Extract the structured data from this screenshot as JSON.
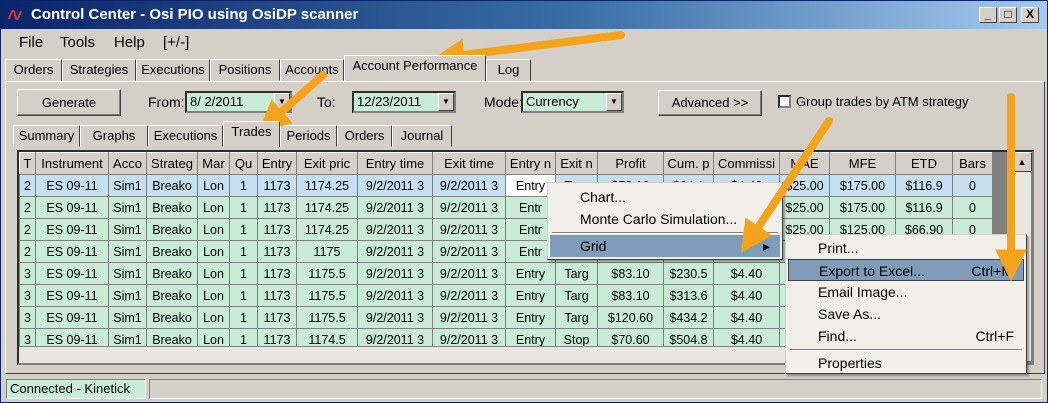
{
  "window": {
    "title": "Control Center - Osi PIO using OsiDP scanner",
    "buttons": {
      "minimize": "_",
      "maximize": "□",
      "close": "X"
    }
  },
  "menubar": [
    "File",
    "Tools",
    "Help",
    "[+/-]"
  ],
  "main_tabs": [
    "Orders",
    "Strategies",
    "Executions",
    "Positions",
    "Accounts",
    "Account Performance",
    "Log"
  ],
  "controls": {
    "generate": "Generate",
    "from_label": "From:",
    "from_value": "8/ 2/2011",
    "to_label": "To:",
    "to_value": "12/23/2011",
    "mode_label": "Mode:",
    "mode_value": "Currency",
    "advanced": "Advanced >>",
    "group_trades": "Group trades by ATM strategy"
  },
  "sub_tabs": [
    "Summary",
    "Graphs",
    "Executions",
    "Trades",
    "Periods",
    "Orders",
    "Journal"
  ],
  "grid": {
    "columns": [
      "T",
      "Instrument",
      "Acco",
      "Strateg",
      "Mar",
      "Qu",
      "Entry",
      "Exit pric",
      "Entry time",
      "Exit time",
      "Entry n",
      "Exit n",
      "Profit",
      "Cum. p",
      "Commissi",
      "MAE",
      "MFE",
      "ETD",
      "Bars"
    ],
    "rows": [
      [
        "2",
        "ES 09-11",
        "Sim1",
        "Breako",
        "Lon",
        "1",
        "1173",
        "1174.25",
        "9/2/2011 3",
        "9/2/2011 3",
        "Entry",
        "Targ",
        "$58.10",
        "$64.1",
        "$4.40",
        "$25.00",
        "$175.00",
        "$116.9",
        "0"
      ],
      [
        "2",
        "ES 09-11",
        "Sim1",
        "Breako",
        "Lon",
        "1",
        "1173",
        "1174.25",
        "9/2/2011 3",
        "9/2/2011 3",
        "Entr",
        "",
        "",
        "",
        "",
        "$25.00",
        "$175.00",
        "$116.9",
        "0"
      ],
      [
        "2",
        "ES 09-11",
        "Sim1",
        "Breako",
        "Lon",
        "1",
        "1173",
        "1174.25",
        "9/2/2011 3",
        "9/2/2011 3",
        "Entr",
        "",
        "",
        "",
        "",
        "$25.00",
        "$125.00",
        "$66.90",
        "0"
      ],
      [
        "2",
        "ES 09-11",
        "Sim1",
        "Breako",
        "Lon",
        "1",
        "1173",
        "1175",
        "9/2/2011 3",
        "9/2/2011 3",
        "Entr",
        "",
        "",
        "",
        "",
        "",
        "",
        "",
        ""
      ],
      [
        "3",
        "ES 09-11",
        "Sim1",
        "Breako",
        "Lon",
        "1",
        "1173",
        "1175.5",
        "9/2/2011 3",
        "9/2/2011 3",
        "Entry",
        "Targ",
        "$83.10",
        "$230.5",
        "$4.40",
        "",
        "",
        "",
        ""
      ],
      [
        "3",
        "ES 09-11",
        "Sim1",
        "Breako",
        "Lon",
        "1",
        "1173",
        "1175.5",
        "9/2/2011 3",
        "9/2/2011 3",
        "Entry",
        "Targ",
        "$83.10",
        "$313.6",
        "$4.40",
        "",
        "",
        "",
        ""
      ],
      [
        "3",
        "ES 09-11",
        "Sim1",
        "Breako",
        "Lon",
        "1",
        "1173",
        "1175.5",
        "9/2/2011 3",
        "9/2/2011 3",
        "Entry",
        "Targ",
        "$120.60",
        "$434.2",
        "$4.40",
        "",
        "",
        "",
        ""
      ],
      [
        "3",
        "ES 09-11",
        "Sim1",
        "Breako",
        "Lon",
        "1",
        "1173",
        "1174.5",
        "9/2/2011 3",
        "9/2/2011 3",
        "Entry",
        "Stop",
        "$70.60",
        "$504.8",
        "$4.40",
        "",
        "",
        "",
        ""
      ]
    ]
  },
  "context_menu": {
    "items": [
      "Chart...",
      "Monte Carlo Simulation...",
      "Grid"
    ],
    "submenu_arrow": "▸"
  },
  "grid_submenu": {
    "items": [
      {
        "label": "Print...",
        "shortcut": ""
      },
      {
        "label": "Export to Excel...",
        "shortcut": "Ctrl+M"
      },
      {
        "label": "Email Image...",
        "shortcut": ""
      },
      {
        "label": "Save As...",
        "shortcut": ""
      },
      {
        "label": "Find...",
        "shortcut": "Ctrl+F"
      },
      {
        "label": "Properties",
        "shortcut": ""
      }
    ]
  },
  "status": {
    "connection": "Connected - Kinetick"
  },
  "colors": {
    "title_gradient_start": "#0a246a",
    "row_green": "#c9ecd6",
    "row_selected": "#c5e0f0",
    "menu_highlight": "#7f9db9",
    "annotation_arrow": "#f5a31a",
    "negative_value": "#c00000"
  }
}
